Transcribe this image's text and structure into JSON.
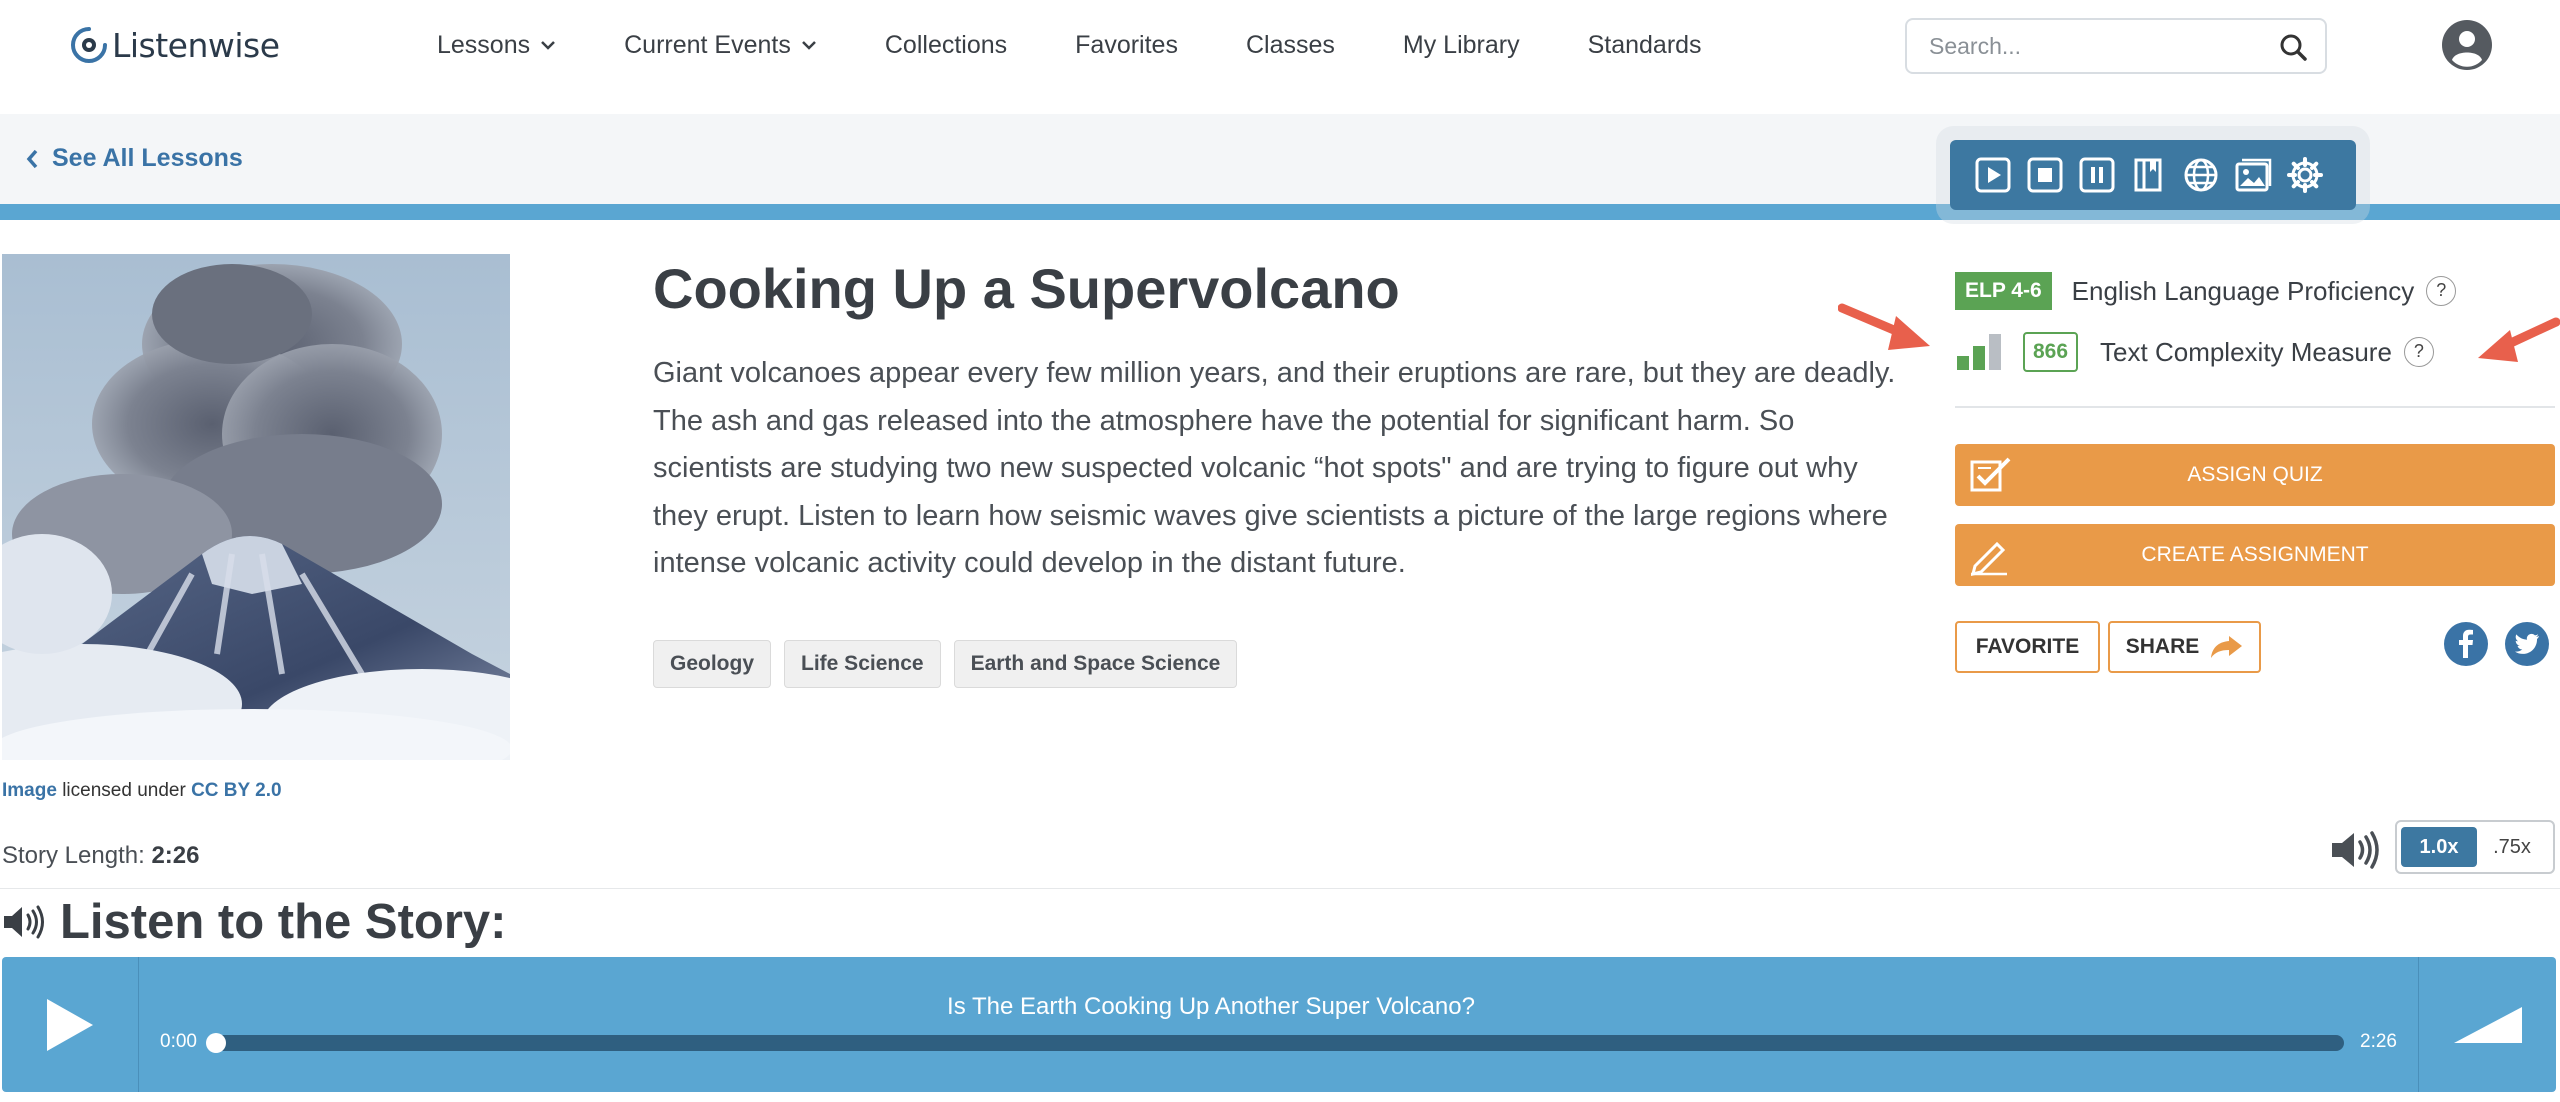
{
  "brand": {
    "name": "Listenwise"
  },
  "nav": {
    "items": [
      {
        "label": "Lessons",
        "has_dropdown": true
      },
      {
        "label": "Current Events",
        "has_dropdown": true
      },
      {
        "label": "Collections",
        "has_dropdown": false
      },
      {
        "label": "Favorites",
        "has_dropdown": false
      },
      {
        "label": "Classes",
        "has_dropdown": false
      },
      {
        "label": "My Library",
        "has_dropdown": false
      },
      {
        "label": "Standards",
        "has_dropdown": false
      }
    ],
    "search_placeholder": "Search..."
  },
  "breadcrumb": {
    "label": "See All Lessons"
  },
  "read_aloud_toolbar": {
    "icons": [
      "play-icon",
      "stop-icon",
      "pause-icon",
      "dictionary-icon",
      "translate-globe-icon",
      "picture-dictionary-icon",
      "settings-gear-icon"
    ]
  },
  "lesson": {
    "title": "Cooking Up a Supervolcano",
    "description": "Giant volcanoes appear every few million years, and their eruptions are rare, but they are deadly. The ash and gas released into the atmosphere have the potential for significant harm. So scientists are studying two new suspected volcanic “hot spots\" and are trying to figure out why they erupt. Listen to learn how seismic waves give scientists a picture of the large regions where intense volcanic activity could develop in the distant future.",
    "tags": [
      "Geology",
      "Life Science",
      "Earth and Space Science"
    ],
    "image_credit": {
      "image_link": "Image",
      "licensed_under": "licensed under",
      "license_link": "CC BY 2.0"
    },
    "story_length_label": "Story Length:",
    "story_length": "2:26"
  },
  "proficiency": {
    "elp_badge": "ELP 4-6",
    "elp_label": "English Language Proficiency",
    "help": "?",
    "complexity_score": "866",
    "complexity_label": "Text Complexity Measure",
    "complexity_level": "2 of 3"
  },
  "actions": {
    "assign_quiz": "ASSIGN QUIZ",
    "create_assignment": "CREATE ASSIGNMENT",
    "favorite": "FAVORITE",
    "share": "SHARE"
  },
  "playback_speed": {
    "options": [
      "1.0x",
      ".75x"
    ],
    "selected": "1.0x"
  },
  "listen": {
    "heading": "Listen to the Story:",
    "track_title": "Is The Earth Cooking Up Another Super Volcano?",
    "current_time": "0:00",
    "total_time": "2:26",
    "progress_fraction": 0.0
  },
  "colors": {
    "brand_blue": "#3d78a1",
    "accent_blue": "#5aa6d2",
    "orange": "#e99a48",
    "green": "#5ba354",
    "annotation_arrow": "#e8604c"
  }
}
